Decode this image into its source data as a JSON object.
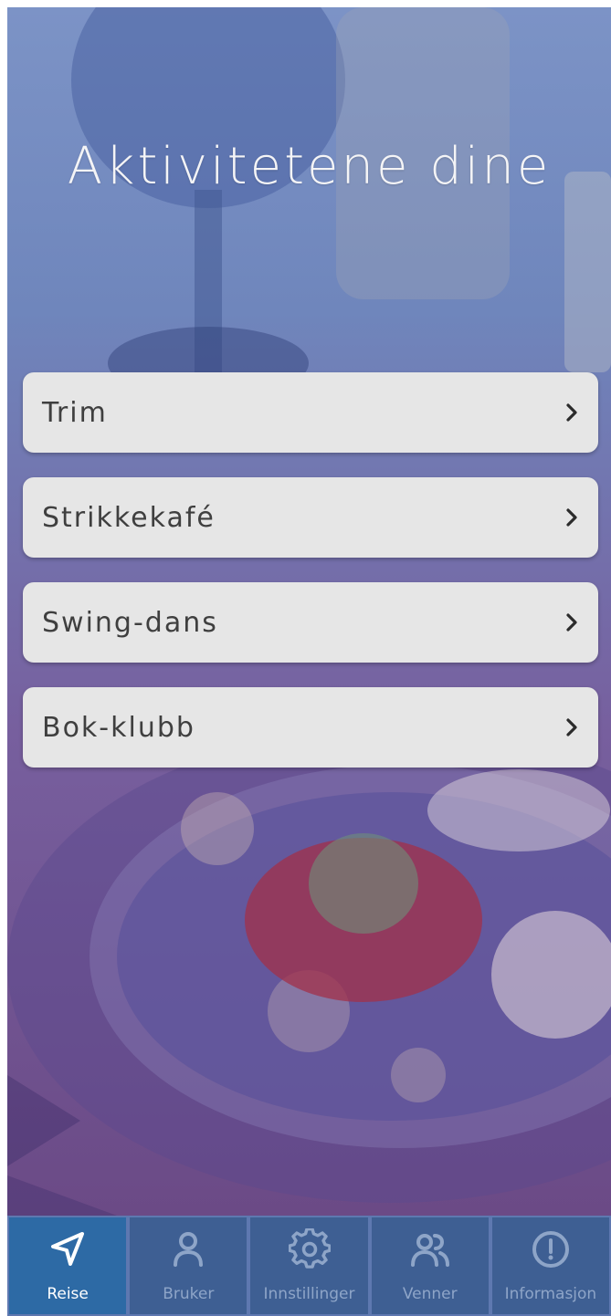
{
  "screen": {
    "title": "Aktivitetene dine"
  },
  "activities": [
    {
      "label": "Trim"
    },
    {
      "label": "Strikkekafé"
    },
    {
      "label": "Swing-dans"
    },
    {
      "label": "Bok-klubb"
    }
  ],
  "tabbar": {
    "tabs": [
      {
        "label": "Reise",
        "icon": "navigation-arrow-icon",
        "active": true
      },
      {
        "label": "Bruker",
        "icon": "user-icon",
        "active": false
      },
      {
        "label": "Innstillinger",
        "icon": "gear-icon",
        "active": false
      },
      {
        "label": "Venner",
        "icon": "friends-icon",
        "active": false
      },
      {
        "label": "Informasjon",
        "icon": "info-icon",
        "active": false
      }
    ]
  },
  "colors": {
    "card_background": "#e6e6e6",
    "tab_background": "#3e5f93",
    "tab_active_background": "#2d6aa5",
    "tab_label": "#8ea5c8",
    "tab_active_label": "#ffffff"
  }
}
